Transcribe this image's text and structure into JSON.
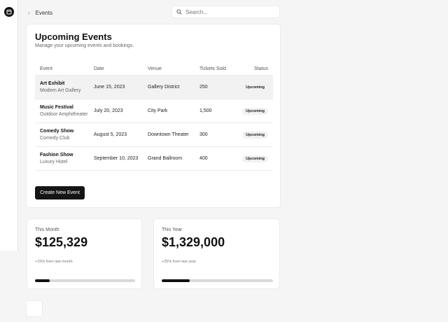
{
  "breadcrumb": {
    "current": "Events"
  },
  "search": {
    "placeholder": "Search..."
  },
  "events_card": {
    "title": "Upcoming Events",
    "subtitle": "Manage your upcoming events and bookings.",
    "columns": [
      "Event",
      "Date",
      "Venue",
      "Tickets Sold",
      "Status"
    ],
    "rows": [
      {
        "name": "Art Exhibit",
        "location": "Modern Art Gallery",
        "date": "June 15, 2023",
        "venue": "Gallery District",
        "tickets": "250",
        "status": "Upcoming"
      },
      {
        "name": "Music Festival",
        "location": "Outdoor Amphitheater",
        "date": "July 20, 2023",
        "venue": "City Park",
        "tickets": "1,500",
        "status": "Upcoming"
      },
      {
        "name": "Comedy Show",
        "location": "Comedy Club",
        "date": "August 5, 2023",
        "venue": "Downtown Theater",
        "tickets": "300",
        "status": "Upcoming"
      },
      {
        "name": "Fashion Show",
        "location": "Luxury Hotel",
        "date": "September 10, 2023",
        "venue": "Grand Ballroom",
        "tickets": "400",
        "status": "Upcoming"
      }
    ],
    "create_label": "Create New Event"
  },
  "stats": [
    {
      "label": "This Month",
      "value": "$125,329",
      "change": "+15% from last month",
      "progress": 0.15
    },
    {
      "label": "This Year",
      "value": "$1,329,000",
      "change": "+25% from last year",
      "progress": 0.25
    }
  ],
  "colors": {
    "accent": "#111111",
    "background": "#f5f5f5",
    "badge": "#f1f1f1",
    "track": "#d9d9d9"
  },
  "icons": {
    "logo": "calendar-icon",
    "breadcrumb": "chevron-right-icon",
    "search": "search-icon"
  }
}
